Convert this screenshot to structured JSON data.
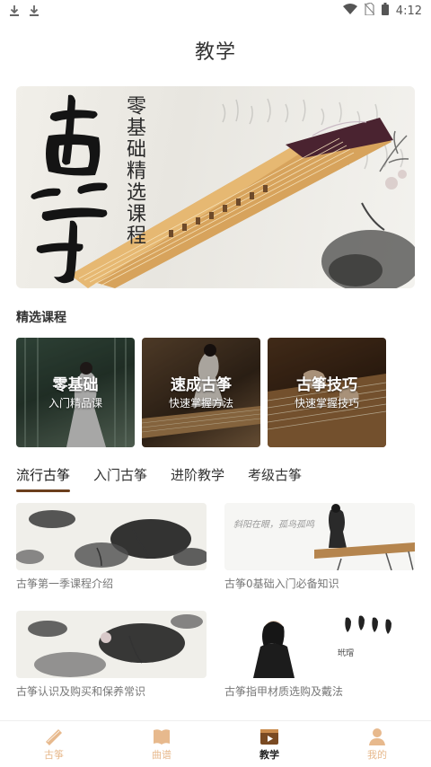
{
  "status": {
    "time": "4:12"
  },
  "page": {
    "title": "教学"
  },
  "banner": {
    "brush_text": "古筝",
    "vertical_text": "零基础精选课程"
  },
  "featured": {
    "title": "精选课程",
    "cards": [
      {
        "title": "零基础",
        "subtitle": "入门精品课"
      },
      {
        "title": "速成古筝",
        "subtitle": "快速掌握方法"
      },
      {
        "title": "古筝技巧",
        "subtitle": "快速掌握技巧"
      }
    ]
  },
  "tabs": [
    {
      "label": "流行古筝",
      "active": true
    },
    {
      "label": "入门古筝",
      "active": false
    },
    {
      "label": "进阶教学",
      "active": false
    },
    {
      "label": "考级古筝",
      "active": false
    }
  ],
  "videos": [
    {
      "title": "古筝第一季课程介绍"
    },
    {
      "title": "古筝0基础入门必备知识",
      "thumb_text": "斜阳在眼，孤鸟孤鸣"
    },
    {
      "title": "古筝认识及购买和保养常识"
    },
    {
      "title": "古筝指甲材质选购及戴法",
      "thumb_text": "玳瑁"
    }
  ],
  "nav": [
    {
      "label": "古筝",
      "icon": "guzheng-icon",
      "active": false
    },
    {
      "label": "曲谱",
      "icon": "book-icon",
      "active": false
    },
    {
      "label": "教学",
      "icon": "video-icon",
      "active": true
    },
    {
      "label": "我的",
      "icon": "user-icon",
      "active": false
    }
  ],
  "colors": {
    "accent": "#6b3e1d",
    "nav_inactive": "#e7b98d"
  }
}
